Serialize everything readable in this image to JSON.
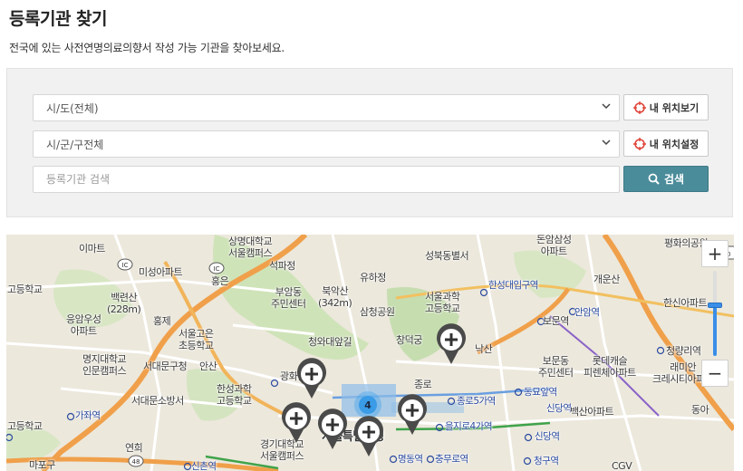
{
  "header": {
    "title": "등록기관 찾기",
    "description": "전국에 있는 사전연명의료의향서 작성 가능 기관을 찾아보세요."
  },
  "search": {
    "sido_value": "시/도(전체)",
    "sigungu_value": "시/군/구전체",
    "keyword_placeholder": "등록기관 검색",
    "my_location_view_label": "내 위치보기",
    "my_location_set_label": "내 위치설정",
    "search_button_label": "검색"
  },
  "map": {
    "cluster_count": "4",
    "zoom_in_label": "+",
    "zoom_out_label": "−",
    "zoom_level_fraction": 0.6,
    "colors": {
      "pin": "#4a4a4a",
      "cluster": "#3a9be6",
      "search_button": "#4a8c9a",
      "major_road": "#f0a04a",
      "park": "#cfe3b8"
    },
    "labels": {
      "l1": "상명대학교\n서울캠퍼스",
      "l2": "돈암삼성\n아파트",
      "l3": "평화의공원",
      "l4": "이마트",
      "l5": "석파정",
      "l6": "유하정",
      "l7": "성북동별서",
      "l8": "미성아파트",
      "l9": "홍은",
      "l10": "부암동\n주민센터",
      "l11": "북악산\n(342m)",
      "l12": "서울과학\n고등학교",
      "l13": "개운산",
      "l14": "고등학교",
      "l15": "백련산\n(228m)",
      "l16": "삼청공원",
      "l17": "한신아파트",
      "l18": "응암우성\n아파트",
      "l19": "홍제",
      "l20": "서울고은\n초등학교",
      "l21": "청와대앞길",
      "l22": "보문역",
      "l23": "창덕궁",
      "l24": "낙산",
      "l25": "청량리역",
      "l26": "명지대학교\n인문캠퍼스",
      "l27": "서대문구청",
      "l28": "안산",
      "l29": "보문동\n주민센터",
      "l30": "롯데캐슬\n피렌체아파트",
      "l31": "래미안\n크레시티아파트",
      "l32": "광화문",
      "l33": "종로5가역",
      "l34": "동묘앞역",
      "l35": "서대문소방서",
      "l36": "한성과학\n고등학교",
      "l37": "종로",
      "l38": "신당역",
      "l39": "백산아파트",
      "l40": "가좌역",
      "l41": "서울특별시청",
      "l42": "을지로4가역",
      "l43": "신당역",
      "l44": "연희",
      "l45": "경기대학교\n서울캠퍼스",
      "l46": "명동역",
      "l47": "충무로역",
      "l48": "청구역",
      "l49": "CGV",
      "l50": "마포구",
      "l51": "신촌역",
      "l52": "고등학교",
      "l53": "안암역",
      "l54": "한성대입구역",
      "l55": "동아"
    }
  }
}
